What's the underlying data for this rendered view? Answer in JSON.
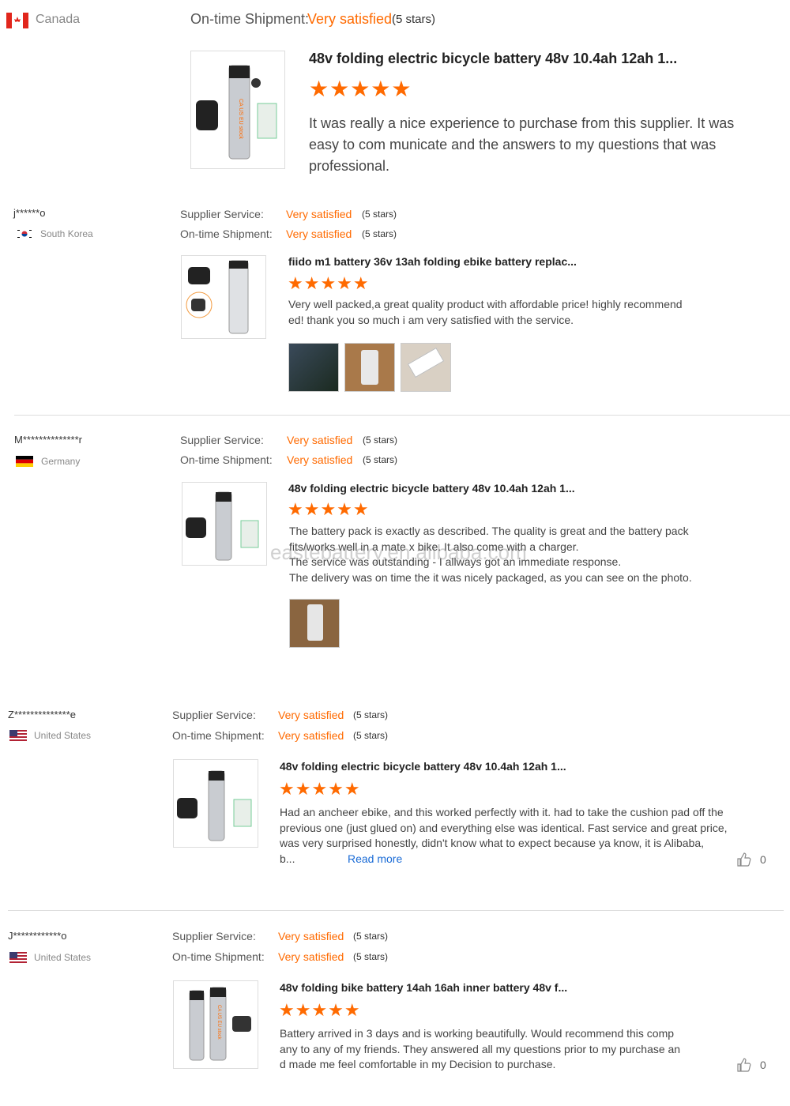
{
  "colors": {
    "accent": "#ff6a00",
    "link": "#1a6bd6"
  },
  "reviews": [
    {
      "user": "",
      "country": "Canada",
      "supplier_label": "",
      "supplier_value": "",
      "supplier_stars": "",
      "shipment_label": "On-time Shipment:",
      "shipment_value": "Very satisfied",
      "shipment_stars": "(5 stars)",
      "product_title": "48v folding electric bicycle battery 48v 10.4ah 12ah 1...",
      "rating_stars": "★★★★★",
      "text": "It was really a nice experience to purchase from this supplier. It was easy to com municate and  the answers to my questions that was professional."
    },
    {
      "user": "j******o",
      "country": "South Korea",
      "supplier_label": "Supplier Service:",
      "supplier_value": "Very satisfied",
      "supplier_stars": "(5 stars)",
      "shipment_label": "On-time Shipment:",
      "shipment_value": "Very satisfied",
      "shipment_stars": "(5 stars)",
      "product_title": "fiido m1 battery 36v 13ah folding ebike battery replac...",
      "rating_stars": "★★★★★",
      "text_lines": [
        "Very well packed,a great quality product with affordable price! highly recommend",
        "ed! thank you so much i am very satisfied with the service."
      ]
    },
    {
      "user": "M**************r",
      "country": "Germany",
      "supplier_label": "Supplier Service:",
      "supplier_value": "Very satisfied",
      "supplier_stars": "(5 stars)",
      "shipment_label": "On-time Shipment:",
      "shipment_value": "Very satisfied",
      "shipment_stars": "(5 stars)",
      "product_title": "48v folding electric bicycle battery 48v 10.4ah 12ah 1...",
      "rating_stars": "★★★★★",
      "text_lines": [
        "The battery pack is exactly as described. The quality is great and the battery pack",
        "fits/works well in a mate x bike. It also come with a charger.",
        "The service was outstanding - I allways got an immediate response.",
        "The delivery was on time the it was nicely packaged, as you can see on the photo."
      ]
    },
    {
      "user": "Z**************e",
      "country": "United States",
      "supplier_label": "Supplier Service:",
      "supplier_value": "Very satisfied",
      "supplier_stars": "(5 stars)",
      "shipment_label": "On-time Shipment:",
      "shipment_value": "Very satisfied",
      "shipment_stars": "(5 stars)",
      "product_title": "48v folding electric bicycle battery 48v 10.4ah 12ah 1...",
      "rating_stars": "★★★★★",
      "text_lines": [
        "Had an ancheer ebike, and this worked perfectly with it. had to take the cushion pad off the",
        "previous one (just glued on) and everything else was identical. Fast service and great price,",
        "was very surprised honestly, didn't know what to expect because ya know, it is Alibaba,",
        "b..."
      ],
      "read_more": "Read more",
      "likes": "0"
    },
    {
      "user": "J************o",
      "country": "United States",
      "supplier_label": "Supplier Service:",
      "supplier_value": "Very satisfied",
      "supplier_stars": "(5 stars)",
      "shipment_label": "On-time Shipment:",
      "shipment_value": "Very satisfied",
      "shipment_stars": "(5 stars)",
      "product_title": "48v folding bike battery 14ah 16ah inner battery 48v f...",
      "rating_stars": "★★★★★",
      "text_lines": [
        "Battery arrived in 3 days and is working beautifully.  Would recommend this comp",
        "any to any of my friends. They answered all my questions prior to my purchase an",
        "d made me feel comfortable in my Decision to purchase."
      ],
      "likes": "0"
    }
  ],
  "watermark": "eastebattery.en.alibaba.com",
  "icons": {
    "like": "thumbs-up-icon"
  }
}
